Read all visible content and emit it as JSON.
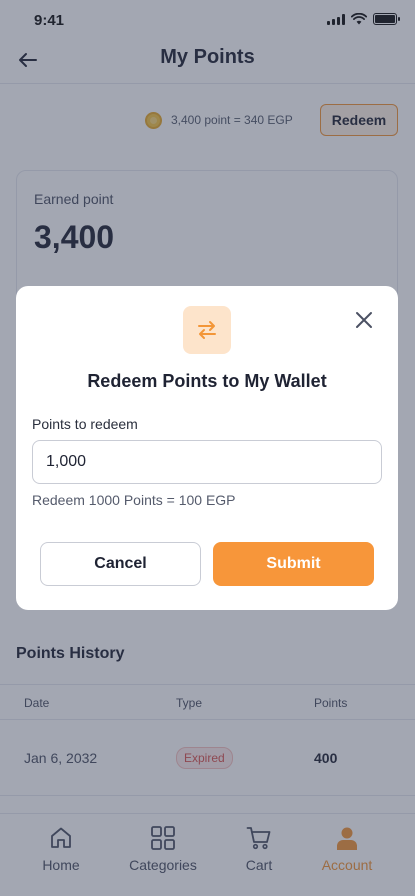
{
  "status_bar": {
    "time": "9:41"
  },
  "header": {
    "title": "My Points"
  },
  "rate": {
    "text": "3,400 point = 340 EGP",
    "redeem_label": "Redeem"
  },
  "earned": {
    "label": "Earned point",
    "value": "3,400"
  },
  "modal": {
    "title": "Redeem Points to My Wallet",
    "field_label": "Points to redeem",
    "input_value": "1,000",
    "conversion": "Redeem 1000 Points = 100 EGP",
    "cancel_label": "Cancel",
    "submit_label": "Submit"
  },
  "history": {
    "title": "Points History",
    "columns": [
      "Date",
      "Type",
      "Points"
    ],
    "rows": [
      {
        "date": "Jan 6, 2032",
        "type": "Expired",
        "points": "400"
      }
    ]
  },
  "tabs": [
    {
      "label": "Home",
      "icon": "home-icon"
    },
    {
      "label": "Categories",
      "icon": "categories-icon"
    },
    {
      "label": "Cart",
      "icon": "cart-icon"
    },
    {
      "label": "Account",
      "icon": "account-icon",
      "active": true
    }
  ],
  "colors": {
    "accent": "#F7963A",
    "accent_light": "#FDE4CB",
    "expired": "#D9534F"
  }
}
